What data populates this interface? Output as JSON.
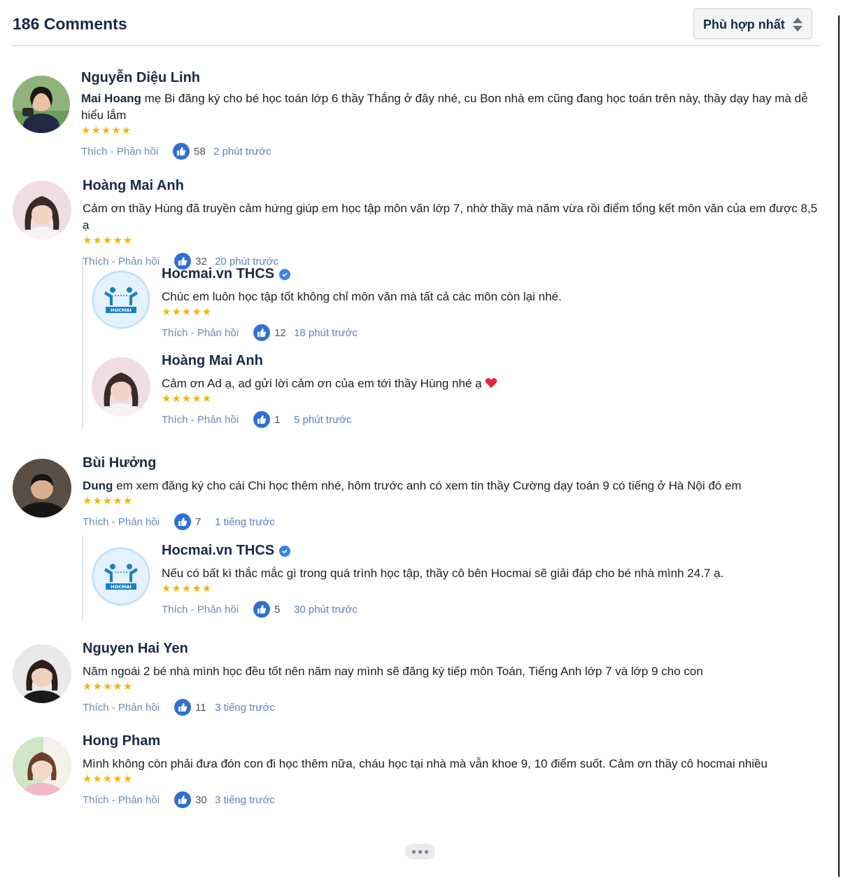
{
  "header": {
    "count_label": "186 Comments",
    "sort_label": "Phù hợp nhất"
  },
  "actions_label": "Thích - Phản hồi",
  "stars": "★★★★★",
  "comments": [
    {
      "name": "Nguyễn Diệu Linh",
      "mention": "Mai Hoang",
      "text": " mẹ Bi đăng ký cho bé học toán lớp 6 thầy Thắng ở đây nhé, cu Bon nhà em cũng đang học toán trên này, thầy dạy hay mà dễ hiểu lắm",
      "likes": "58",
      "time": "2 phút trước"
    },
    {
      "name": "Hoàng Mai Anh",
      "mention": "",
      "text": "Cảm ơn thầy Hùng đã truyền cảm hứng giúp em học tập môn văn lớp 7, nhờ thầy mà năm vừa rồi điểm tổng kết môn văn của em được 8,5 ạ",
      "likes": "32",
      "time": "20 phút trước",
      "replies": [
        {
          "name": "Hocmai.vn THCS",
          "text": "Chúc em luôn học tập tốt không chỉ môn văn mà tất cả các môn còn lại nhé.",
          "likes": "12",
          "time": "18 phút trước"
        },
        {
          "name": "Hoàng Mai Anh",
          "text": "Cảm ơn Ad ạ, ad gửi lời cảm ơn của em tới thầy Hùng nhé ạ",
          "likes": "1",
          "time": "5 phút trước"
        }
      ]
    },
    {
      "name": "Bùi Hưởng",
      "mention": "Dung",
      "text": " em xem đăng ký cho cái Chi học thêm nhé, hôm trước anh có xem tin thầy Cường dạy toán 9 có tiếng ở Hà Nội đó em",
      "likes": "7",
      "time": "1 tiếng trước",
      "replies": [
        {
          "name": "Hocmai.vn THCS",
          "text": "Nếu có bất kì thắc mắc gì trong quá trình học tập, thầy cô bên Hocmai sẽ giải đáp cho bé nhà mình 24.7 ạ.",
          "likes": "5",
          "time": "30 phút trước"
        }
      ]
    },
    {
      "name": "Nguyen Hai Yen",
      "mention": "",
      "text": "Năm ngoái 2 bé nhà mình học đều tốt nên năm nay mình sẽ đăng ký tiếp môn Toán, Tiếng Anh lớp 7 và lớp 9 cho con",
      "likes": "11",
      "time": "3 tiếng trước"
    },
    {
      "name": "Hong Pham",
      "mention": "",
      "text": "Mình không còn phải đưa đón con đi học thêm nữa, cháu học tại nhà mà vẫn khoe 9, 10 điểm suốt. Cảm ơn thầy cô hocmai nhiều",
      "likes": "30",
      "time": "3 tiếng trước"
    }
  ],
  "logo_text": "HOCMAI",
  "colors": {
    "name": "#1a2a44",
    "star": "#f5b400",
    "link": "#5b7fc0",
    "like": "#2f6fd6"
  }
}
